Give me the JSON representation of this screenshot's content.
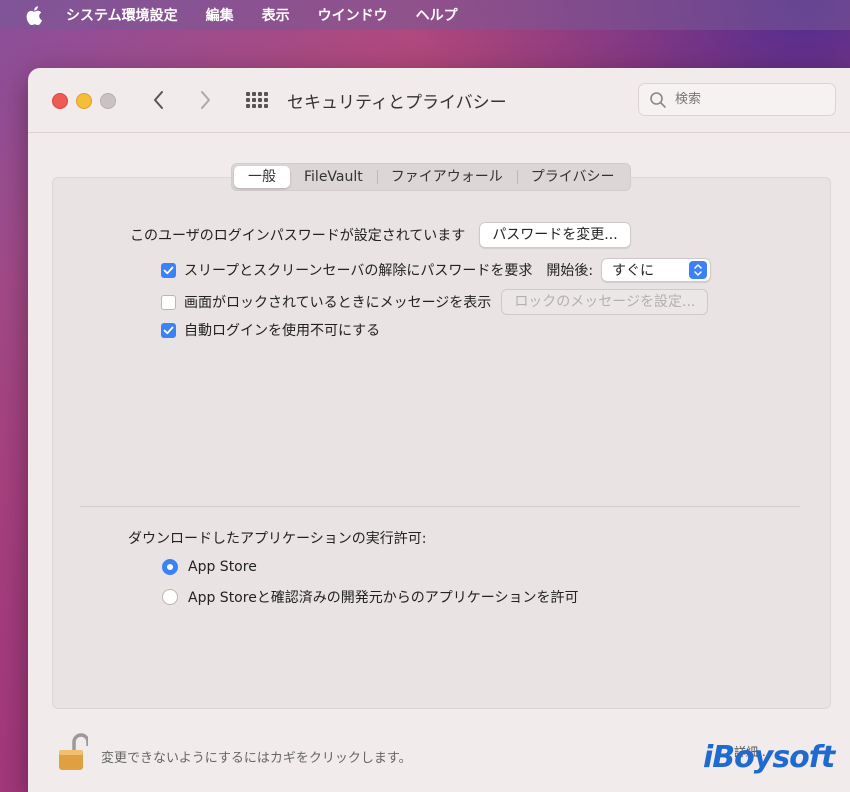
{
  "menubar": {
    "app_name": "システム環境設定",
    "items": [
      "編集",
      "表示",
      "ウインドウ",
      "ヘルプ"
    ]
  },
  "window": {
    "title": "セキュリティとプライバシー",
    "search_placeholder": "検索"
  },
  "tabs": [
    {
      "label": "一般",
      "active": true
    },
    {
      "label": "FileVault",
      "active": false
    },
    {
      "label": "ファイアウォール",
      "active": false
    },
    {
      "label": "プライバシー",
      "active": false
    }
  ],
  "general": {
    "login_password_text": "このユーザのログインパスワードが設定されています",
    "change_password_button": "パスワードを変更...",
    "require_password": {
      "label": "スリープとスクリーンセーバの解除にパスワードを要求",
      "checked": true
    },
    "after_label": "開始後:",
    "after_value": "すぐに",
    "show_message": {
      "label": "画面がロックされているときにメッセージを表示",
      "checked": false
    },
    "set_lock_message_button": "ロックのメッセージを設定...",
    "disable_auto_login": {
      "label": "自動ログインを使用不可にする",
      "checked": true
    }
  },
  "downloads": {
    "heading": "ダウンロードしたアプリケーションの実行許可:",
    "options": [
      {
        "label": "App Store",
        "selected": true
      },
      {
        "label": "App Storeと確認済みの開発元からのアプリケーションを許可",
        "selected": false
      }
    ]
  },
  "footer": {
    "lock_text": "変更できないようにするにはカギをクリックします。",
    "detail_button": "詳細...",
    "watermark": "iBoysoft"
  },
  "colors": {
    "accent": "#3b82f6",
    "close": "#ee5b54",
    "minimize": "#f6bd3b",
    "lock": "#e0a040"
  }
}
